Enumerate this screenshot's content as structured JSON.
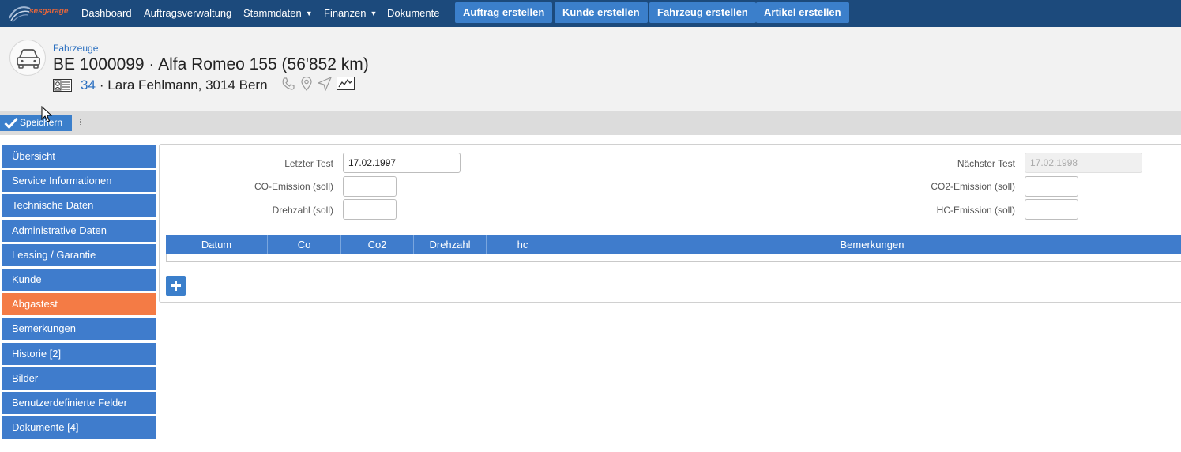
{
  "nav": {
    "logo_text": "sesgarage",
    "links": [
      "Dashboard",
      "Auftragsverwaltung",
      "Stammdaten",
      "Finanzen",
      "Dokumente"
    ],
    "actions": [
      "Auftrag erstellen",
      "Kunde erstellen",
      "Fahrzeug erstellen",
      "Artikel erstellen"
    ]
  },
  "header": {
    "breadcrumb": "Fahrzeuge",
    "title": "BE 1000099 · Alfa Romeo 155 (56'852 km)",
    "customer_number": "34",
    "customer_rest": "· Lara Fehlmann, 3014 Bern"
  },
  "toolbar": {
    "save_label": "Speichern"
  },
  "sidebar": {
    "items": [
      "Übersicht",
      "Service Informationen",
      "Technische Daten",
      "Administrative Daten",
      "Leasing / Garantie",
      "Kunde",
      "Abgastest",
      "Bemerkungen",
      "Historie [2]",
      "Bilder",
      "Benutzerdefinierte Felder",
      "Dokumente [4]"
    ],
    "active": "Abgastest"
  },
  "form": {
    "letzter_test_label": "Letzter Test",
    "letzter_test_value": "17.02.1997",
    "co_label": "CO-Emission (soll)",
    "co_value": "",
    "drehzahl_label": "Drehzahl (soll)",
    "drehzahl_value": "",
    "naechster_test_label": "Nächster Test",
    "naechster_test_value": "17.02.1998",
    "co2_label": "CO2-Emission (soll)",
    "co2_value": "",
    "hc_label": "HC-Emission (soll)",
    "hc_value": ""
  },
  "grid": {
    "columns": [
      "Datum",
      "Co",
      "Co2",
      "Drehzahl",
      "hc",
      "Bemerkungen"
    ]
  },
  "colors": {
    "nav_bg": "#1c4a7c",
    "accent_blue": "#3f7ccc",
    "active_orange": "#f47b45"
  }
}
